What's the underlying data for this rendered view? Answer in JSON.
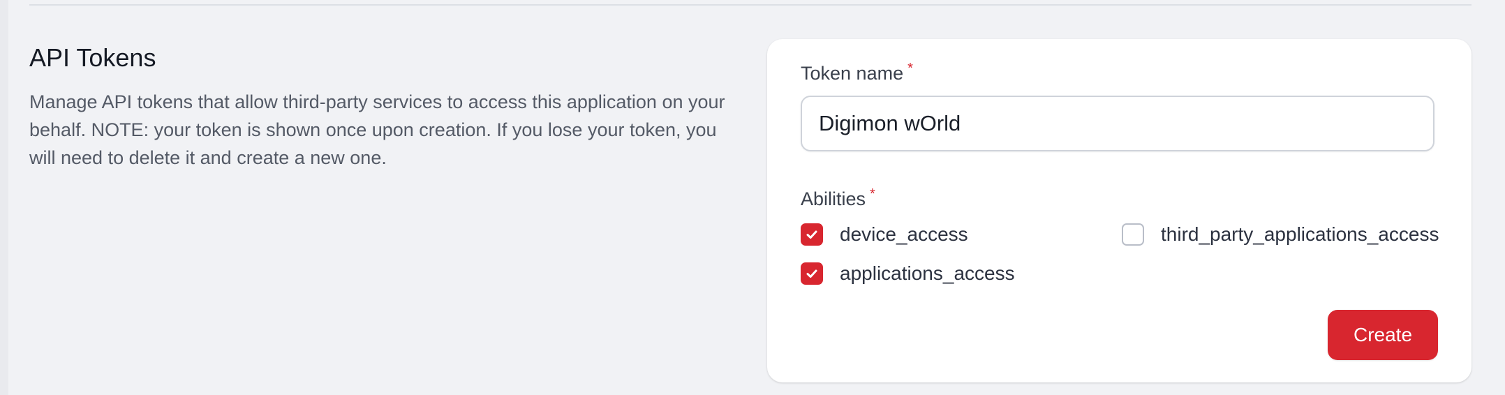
{
  "section": {
    "title": "API Tokens",
    "description": "Manage API tokens that allow third-party services to access this application on your behalf. NOTE: your token is shown once upon creation. If you lose your token, you will need to delete it and create a new one."
  },
  "form": {
    "token_name_label": "Token name",
    "required_marker": "*",
    "token_name_value": "Digimon wOrld",
    "abilities_label": "Abilities",
    "abilities": [
      {
        "label": "device_access",
        "checked": true
      },
      {
        "label": "third_party_applications_access",
        "checked": false
      },
      {
        "label": "applications_access",
        "checked": true
      }
    ],
    "create_label": "Create"
  },
  "colors": {
    "accent": "#d8262f",
    "background": "#f1f2f5",
    "card": "#ffffff"
  },
  "icons": {
    "checked": "check-icon"
  }
}
